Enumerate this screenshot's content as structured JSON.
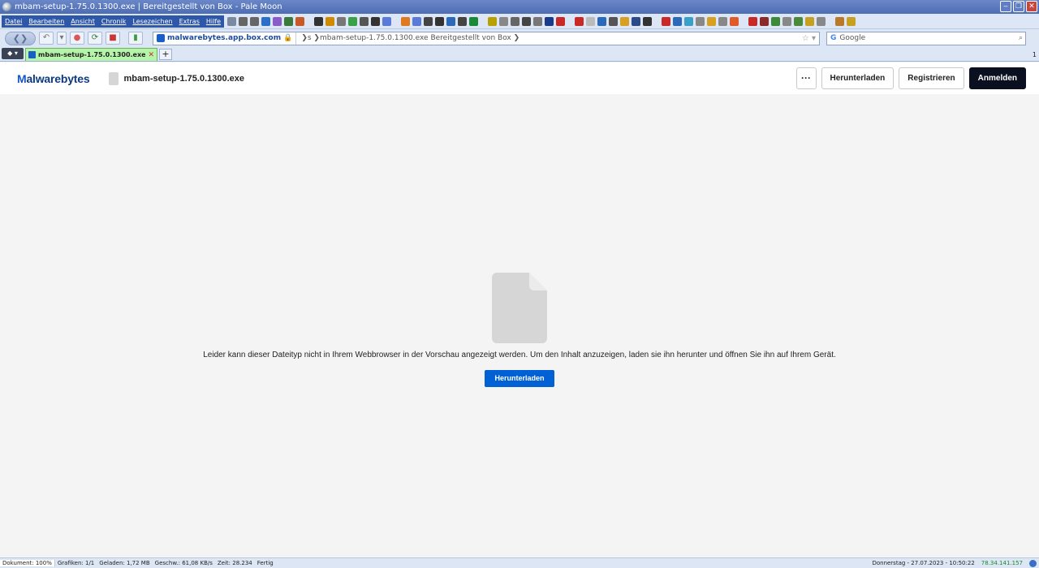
{
  "window": {
    "title": "mbam-setup-1.75.0.1300.exe | Bereitgestellt von Box - Pale Moon",
    "minimize": "‒",
    "restore": "❐",
    "close": "✕"
  },
  "menu": [
    "Datei",
    "Bearbeiten",
    "Ansicht",
    "Chronik",
    "Lesezeichen",
    "Extras",
    "Hilfe"
  ],
  "toolbar_icon_colors": [
    "#7a8aa0",
    "#666",
    "#666",
    "#2a70c8",
    "#8a5cc8",
    "#3a7a3a",
    "#c85a2a",
    "#333",
    "#d08a00",
    "#777",
    "#3aa04a",
    "#555",
    "#333",
    "#5a7ad8",
    "#e07a20",
    "#5a7ad8",
    "#444",
    "#333",
    "#2a6ab8",
    "#444",
    "#1a8a3a",
    "#b8a000",
    "#888",
    "#666",
    "#444",
    "#777",
    "#1a3a8a",
    "#c82a2a",
    "#c82a2a",
    "#bbb",
    "#2a6ab8",
    "#555",
    "#d8a020",
    "#2a4a8a",
    "#333",
    "#c82a2a",
    "#2a6ab8",
    "#3aa0c8",
    "#888",
    "#d8a020",
    "#888",
    "#e05a2a",
    "#c82a2a",
    "#8a2a2a",
    "#3a8a3a",
    "#888",
    "#4a8a3a",
    "#c8a020",
    "#888",
    "#b87a2a",
    "#c8a020"
  ],
  "nav": {
    "back_forward": "❮❯",
    "url_site": "malwarebytes.app.box.com",
    "url_path": "❯s ❯mbam-setup-1.75.0.1300.exe Bereitgestellt von Box ❯",
    "url_right": "☆ ▾",
    "search_engine": "G",
    "search_placeholder": "Google",
    "search_icon": "⌕"
  },
  "tabs": {
    "list_button": "◆ ▾",
    "active_title": "mbam-setup-1.75.0.1300.exe | Ber",
    "close": "✕",
    "new_tab": "+",
    "count": "1"
  },
  "header": {
    "brand_m": "M",
    "brand_rest": "alwarebytes",
    "file_name": "mbam-setup-1.75.0.1300.exe",
    "more_label": "···",
    "download_label": "Herunterladen",
    "register_label": "Registrieren",
    "login_label": "Anmelden"
  },
  "preview": {
    "message": "Leider kann dieser Dateityp nicht in Ihrem Webbrowser in der Vorschau angezeigt werden. Um den Inhalt anzuzeigen, laden sie ihn herunter und öffnen Sie ihn auf Ihrem Gerät.",
    "download_label": "Herunterladen"
  },
  "status": {
    "document": "Dokument: 100%",
    "graphics": "Grafiken: 1/1",
    "loaded": "Geladen: 1,72 MB",
    "speed": "Geschw.: 61,08 KB/s",
    "time": "Zeit: 28.234",
    "state": "Fertig",
    "datetime": "Donnerstag - 27.07.2023 - 10:50:22",
    "ip": "78.34.141.157"
  }
}
